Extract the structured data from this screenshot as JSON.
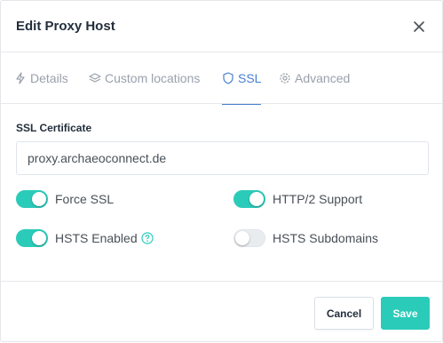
{
  "modal": {
    "title": "Edit Proxy Host",
    "close_icon": "close-icon"
  },
  "tabs": [
    {
      "label": "Details",
      "icon": "lightning-icon",
      "active": false
    },
    {
      "label": "Custom locations",
      "icon": "layers-icon",
      "active": false
    },
    {
      "label": "SSL",
      "icon": "shield-icon",
      "active": true
    },
    {
      "label": "Advanced",
      "icon": "gear-icon",
      "active": false
    }
  ],
  "ssl": {
    "certificate_label": "SSL Certificate",
    "certificate_value": "proxy.archaeoconnect.de",
    "toggles": [
      {
        "label": "Force SSL",
        "on": true
      },
      {
        "label": "HTTP/2 Support",
        "on": true
      },
      {
        "label": "HSTS Enabled",
        "on": true,
        "help_icon": "help-circle-icon"
      },
      {
        "label": "HSTS Subdomains",
        "on": false
      }
    ]
  },
  "footer": {
    "cancel_label": "Cancel",
    "save_label": "Save"
  },
  "colors": {
    "accent_teal": "#2bcbba",
    "active_tab": "#467fcf",
    "muted_text": "#9aa0ac"
  }
}
